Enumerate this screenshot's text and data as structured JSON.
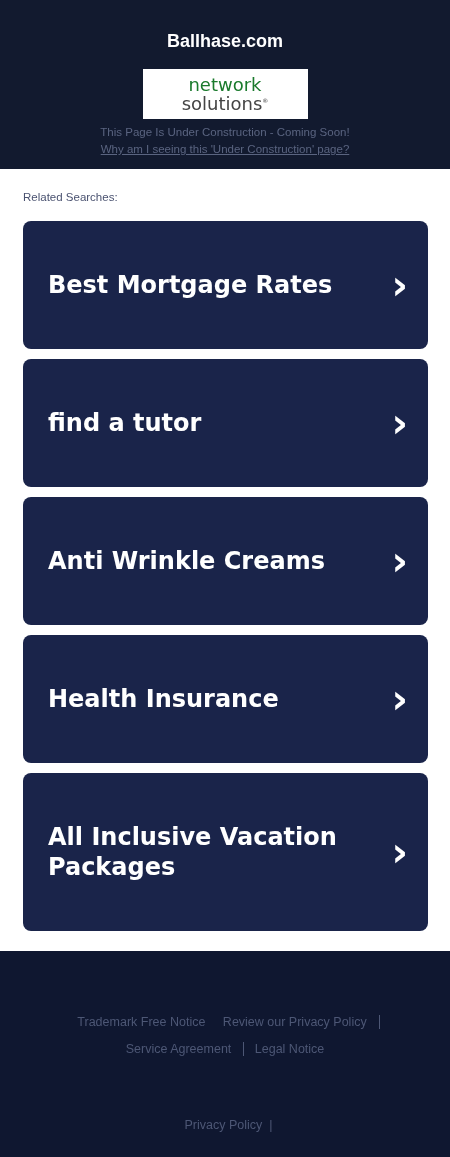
{
  "header": {
    "title": "Ballhase.com",
    "logo": {
      "line_1": "network",
      "line_2": "solutions",
      "mark": "®"
    },
    "notice": "This Page Is Under Construction - Coming Soon!",
    "notice_link": "Why am I seeing this 'Under Construction' page?"
  },
  "related": {
    "heading": "Related Searches:",
    "items": [
      {
        "label": "Best Mortgage Rates",
        "arrow": "›"
      },
      {
        "label": "find a tutor",
        "arrow": "›"
      },
      {
        "label": "Anti Wrinkle Creams",
        "arrow": "›"
      },
      {
        "label": "Health Insurance",
        "arrow": "›"
      },
      {
        "label": "All Inclusive Vacation Packages",
        "arrow": "›"
      }
    ]
  },
  "footer": {
    "links": [
      {
        "label": "Trademark Free Notice",
        "divider_after": false
      },
      {
        "label": "Review our Privacy Policy",
        "divider_after": true
      },
      {
        "label": "Service Agreement",
        "divider_after": true
      },
      {
        "label": "Legal Notice",
        "divider_after": false
      }
    ],
    "bottom_link": "Privacy Policy",
    "bottom_separator": "|"
  }
}
